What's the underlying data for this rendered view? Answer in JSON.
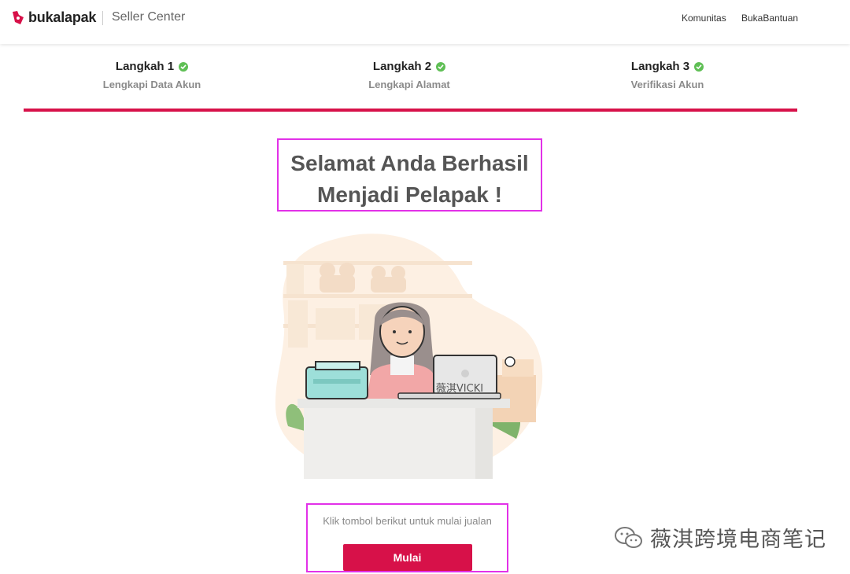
{
  "header": {
    "logo_text": "bukalapak",
    "app_name": "Seller Center",
    "nav": [
      "Komunitas",
      "BukaBantuan"
    ],
    "brand_color": "#d71149"
  },
  "steps": [
    {
      "title": "Langkah 1",
      "subtitle": "Lengkapi Data Akun",
      "done": true
    },
    {
      "title": "Langkah 2",
      "subtitle": "Lengkapi Alamat",
      "done": true
    },
    {
      "title": "Langkah 3",
      "subtitle": "Verifikasi Akun",
      "done": true
    }
  ],
  "main": {
    "title_line1": "Selamat Anda Berhasil",
    "title_line2": "Menjadi Pelapak !",
    "laptop_watermark": "薇淇VICKI",
    "cta_text": "Klik tombol berikut untuk mulai jualan",
    "cta_button": "Mulai"
  },
  "watermark": {
    "text": "薇淇跨境电商笔记",
    "icon": "wechat-icon"
  }
}
